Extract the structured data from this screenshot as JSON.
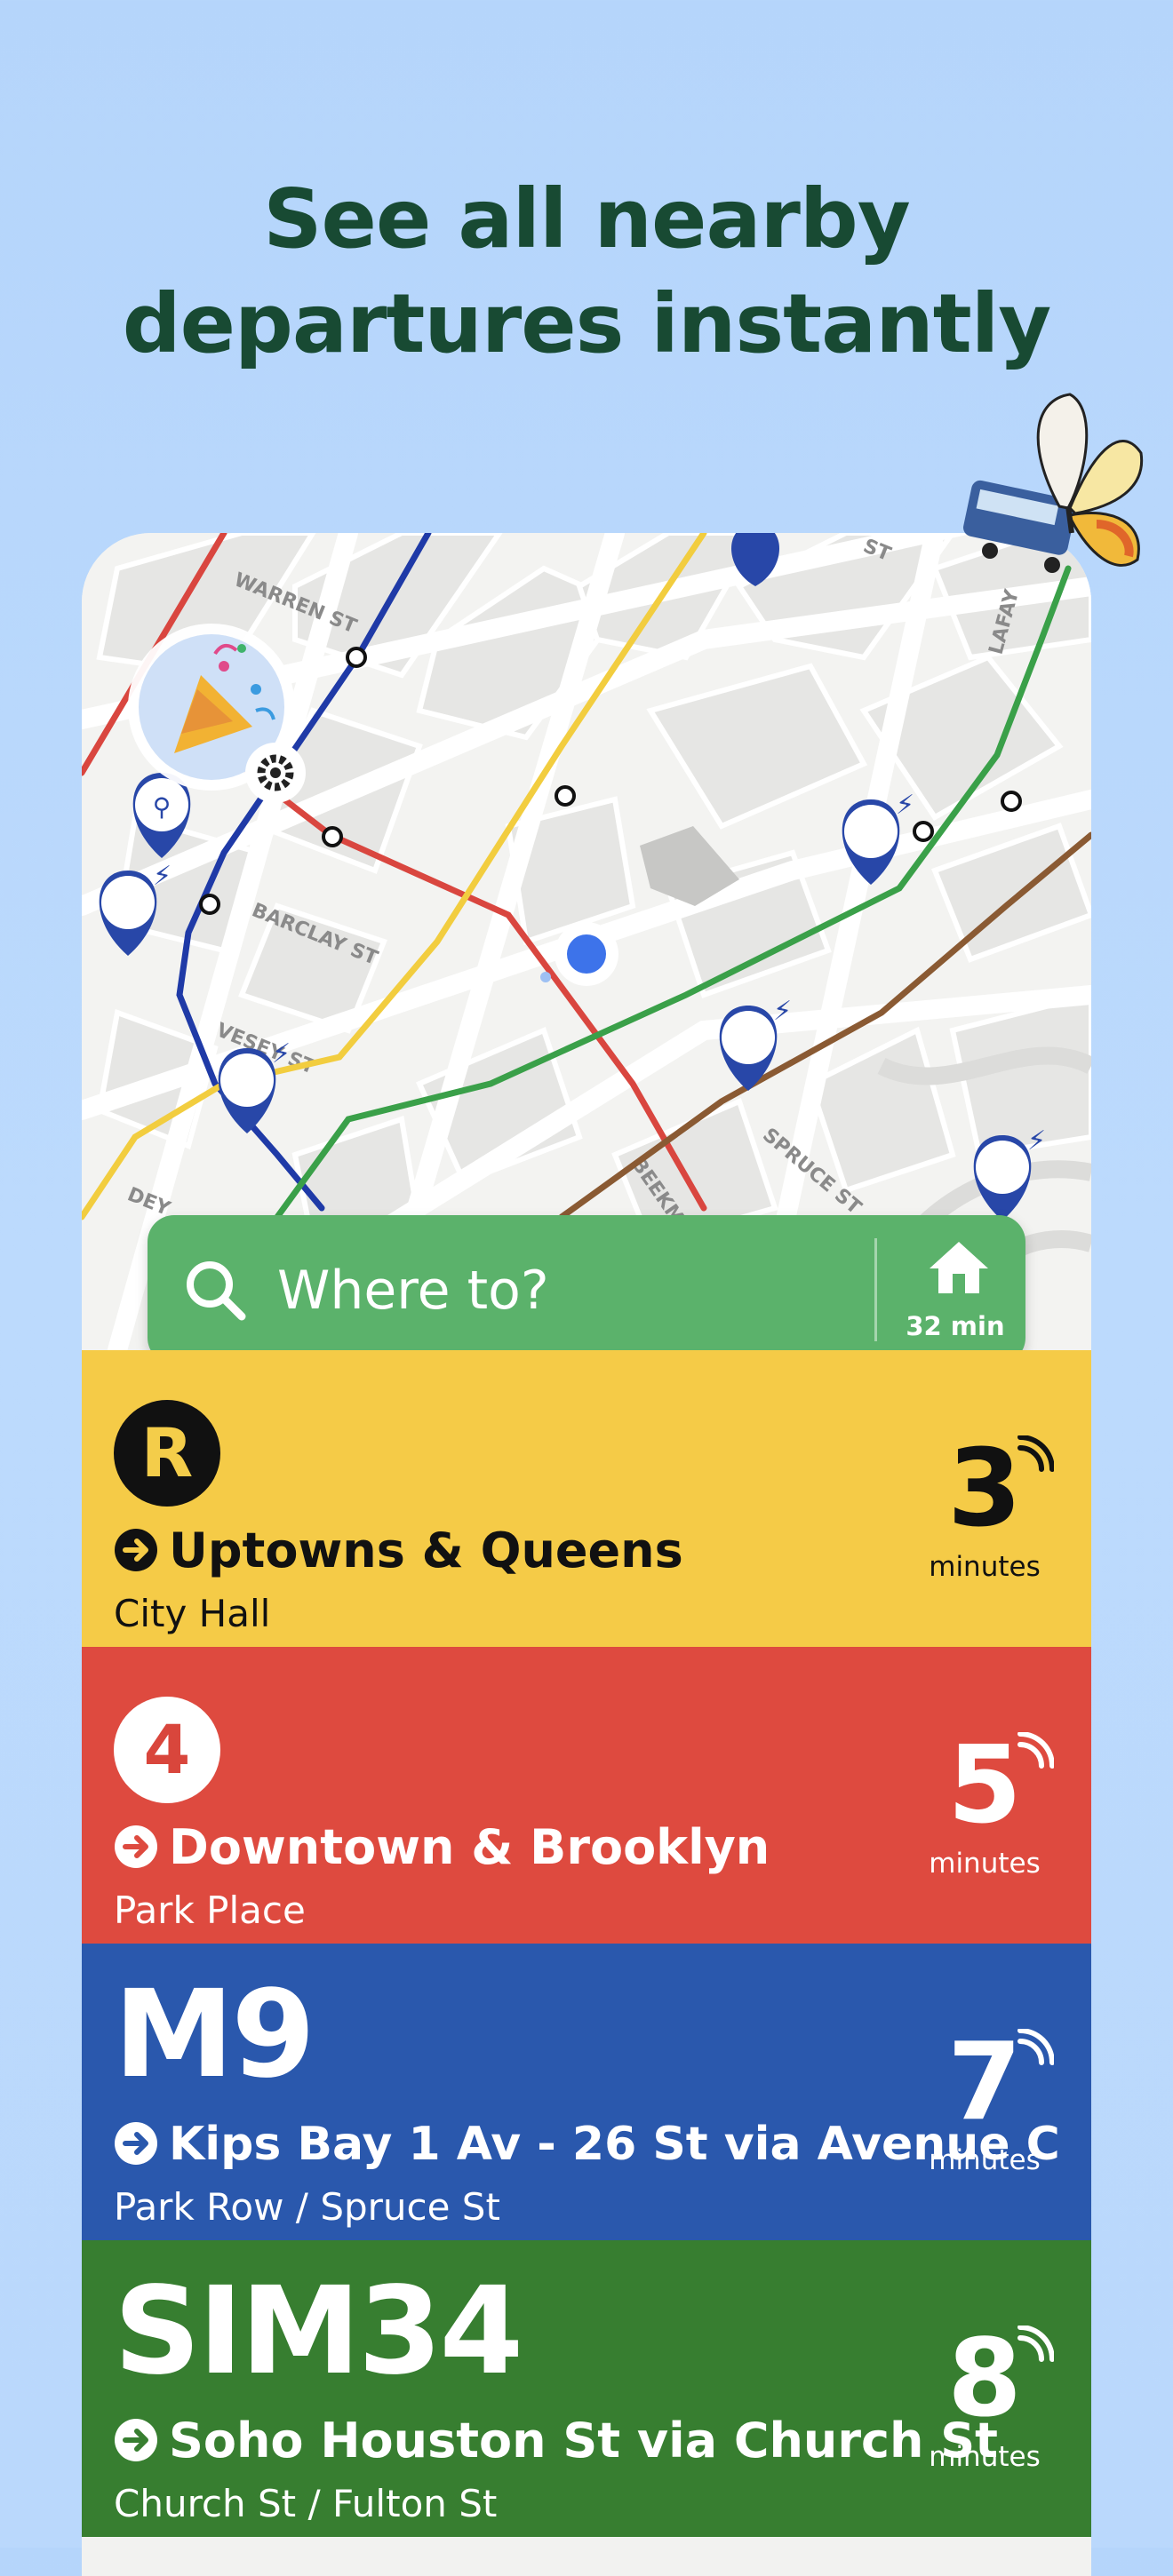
{
  "headline": {
    "line1": "See all nearby",
    "line2": "departures instantly"
  },
  "map": {
    "street_labels": [
      "WARREN ST",
      "BARCLAY ST",
      "VESEY ST",
      "SPRUCE ST",
      "BEEKMAN",
      "LAFAY",
      "DEY",
      "ST"
    ],
    "user_location_color": "#3d73ea",
    "line_colors": {
      "red": "#d9463f",
      "blue": "#1f3aa7",
      "yellow": "#f2cd3f",
      "green": "#3aa049",
      "brown": "#8a5a33"
    },
    "bike_pin_color": "#2847a8",
    "settings_badge_icon": "gear-icon",
    "avatar_icon": "party-popper-icon"
  },
  "search": {
    "placeholder": "Where to?",
    "home_time": "32 min",
    "accent": "#5bb26b"
  },
  "departures": [
    {
      "route": "R",
      "style": "circle",
      "route_badge_bg": "#111111",
      "route_badge_fg": "#f4cd4a",
      "bg": "#f5cb47",
      "text_color": "#111111",
      "destination": "Uptowns & Queens",
      "stop": "City Hall",
      "minutes": "3",
      "minutes_label": "minutes"
    },
    {
      "route": "4",
      "style": "circle",
      "route_badge_bg": "#ffffff",
      "route_badge_fg": "#d9463c",
      "bg": "#de4a3f",
      "text_color": "#ffffff",
      "destination": "Downtown & Brooklyn",
      "stop": "Park Place",
      "minutes": "5",
      "minutes_label": "minutes"
    },
    {
      "route": "M9",
      "style": "big",
      "bg": "#2a58ad",
      "text_color": "#ffffff",
      "destination": "Kips Bay 1 Av - 26 St via Avenue C",
      "stop": "Park Row / Spruce St",
      "minutes": "7",
      "minutes_label": "minutes"
    },
    {
      "route": "SIM34",
      "style": "big",
      "bg": "#377e30",
      "text_color": "#ffffff",
      "destination": "Soho Houston St via Church St",
      "stop": "Church St / Fulton St",
      "minutes": "8",
      "minutes_label": "minutes"
    }
  ]
}
